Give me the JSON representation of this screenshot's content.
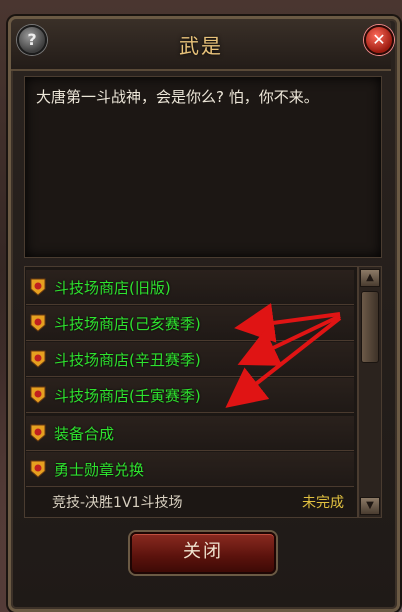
{
  "window": {
    "title": "武是"
  },
  "help_button": {
    "label": "?"
  },
  "close_x": {
    "label": "✕"
  },
  "dialog": {
    "text": "大唐第一斗战神，会是你么? 怕，你不来。"
  },
  "options": [
    {
      "label": "斗技场商店(旧版)"
    },
    {
      "label": "斗技场商店(己亥赛季)"
    },
    {
      "label": "斗技场商店(辛丑赛季)"
    },
    {
      "label": "斗技场商店(壬寅赛季)"
    },
    {
      "label": "装备合成"
    },
    {
      "label": "勇士勋章兑换"
    }
  ],
  "quest": {
    "name": "竞技-决胜1V1斗技场",
    "status": "未完成"
  },
  "scroll": {
    "up": "▲",
    "down": "▼"
  },
  "footer": {
    "close_label": "关闭"
  },
  "colors": {
    "option_text": "#2fe22f",
    "title": "#e8c27a",
    "status": "#e0c040",
    "arrow": "#e01414"
  }
}
